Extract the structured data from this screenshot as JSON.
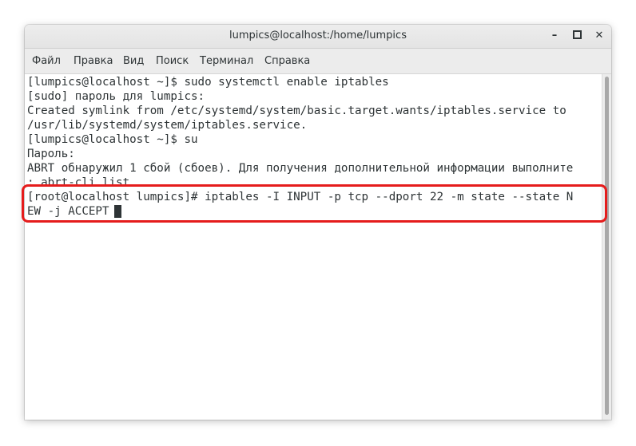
{
  "window": {
    "title": "lumpics@localhost:/home/lumpics",
    "minimize_glyph": "–",
    "close_glyph": "✕"
  },
  "menu": [
    {
      "label": "Файл"
    },
    {
      "label": "Правка"
    },
    {
      "label": "Вид"
    },
    {
      "label": "Поиск"
    },
    {
      "label": "Терминал"
    },
    {
      "label": "Справка"
    }
  ],
  "terminal": {
    "lines": [
      "[lumpics@localhost ~]$ sudo systemctl enable iptables",
      "[sudo] пароль для lumpics:",
      "Created symlink from /etc/systemd/system/basic.target.wants/iptables.service to",
      "/usr/lib/systemd/system/iptables.service.",
      "[lumpics@localhost ~]$ su",
      "Пароль:",
      "ABRT обнаружил 1 сбой (сбоев). Для получения дополнительной информации выполните",
      ": abrt-cli list",
      "[root@localhost lumpics]# iptables -I INPUT -p tcp --dport 22 -m state --state N",
      "EW -j ACCEPT"
    ]
  },
  "highlight_color": "#e51c1c"
}
